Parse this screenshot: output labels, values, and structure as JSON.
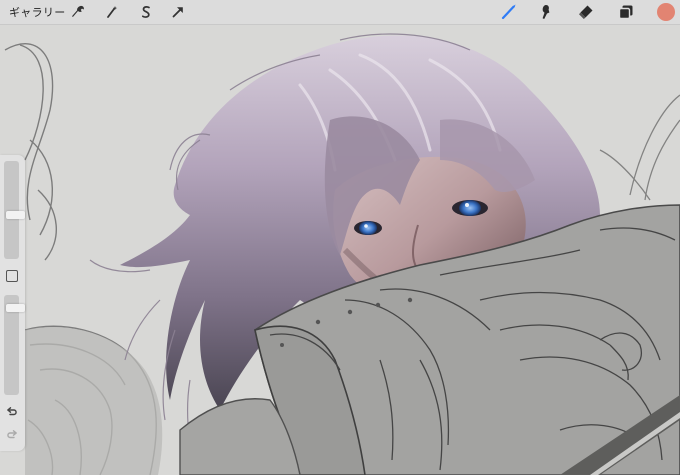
{
  "toolbar": {
    "gallery_label": "ギャラリー",
    "left_tools": [
      "wrench-icon",
      "magic-wand-icon",
      "selection-icon",
      "transform-arrow-icon"
    ],
    "right_tools": [
      "brush-icon",
      "smudge-icon",
      "eraser-icon",
      "layers-icon"
    ],
    "active_tool": "brush-icon",
    "active_color": "#e28472",
    "accent_color": "#2f7cf6"
  },
  "sidebar": {
    "brush_size_level": 0.45,
    "brush_opacity_level": 0.9,
    "controls": [
      "modify-button",
      "undo-icon",
      "redo-icon"
    ]
  },
  "canvas": {
    "description_colors": {
      "background": "#d8d8d6",
      "armor": "#a3a3a1",
      "hair": "#b7a8bc",
      "eyes": "#3f79c9"
    }
  }
}
